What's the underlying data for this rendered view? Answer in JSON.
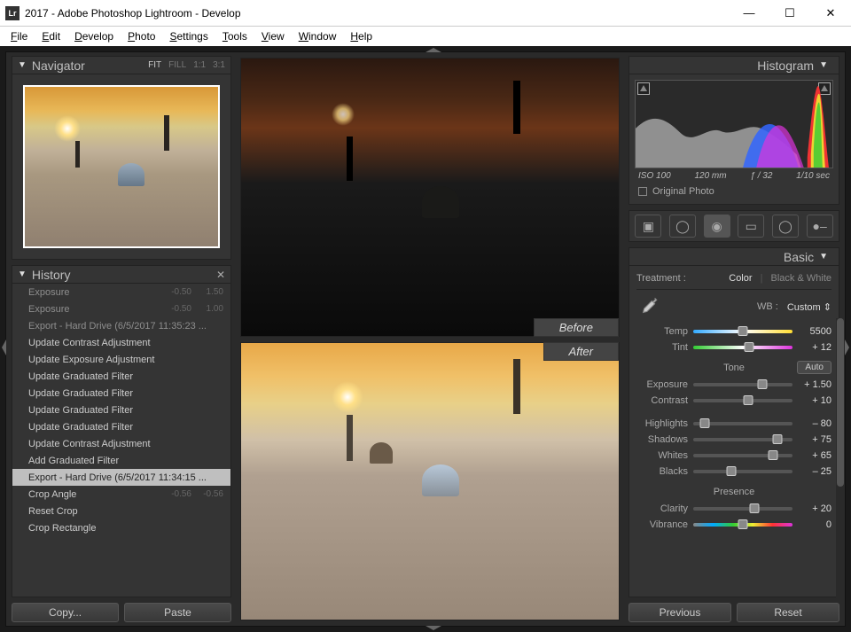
{
  "titlebar": {
    "title": "2017 - Adobe Photoshop Lightroom - Develop"
  },
  "menu": [
    "File",
    "Edit",
    "Develop",
    "Photo",
    "Settings",
    "Tools",
    "View",
    "Window",
    "Help"
  ],
  "navigator": {
    "title": "Navigator",
    "modes": [
      "FIT",
      "FILL",
      "1:1",
      "3:1"
    ],
    "active": "FIT"
  },
  "history": {
    "title": "History",
    "items": [
      {
        "label": "Exposure",
        "v1": "-0.50",
        "v2": "1.50",
        "dim": true
      },
      {
        "label": "Exposure",
        "v1": "-0.50",
        "v2": "1.00",
        "dim": true
      },
      {
        "label": "Export - Hard Drive (6/5/2017 11:35:23 ...",
        "dim": true
      },
      {
        "label": "Update Contrast Adjustment"
      },
      {
        "label": "Update Exposure Adjustment"
      },
      {
        "label": "Update Graduated Filter"
      },
      {
        "label": "Update Graduated Filter"
      },
      {
        "label": "Update Graduated Filter"
      },
      {
        "label": "Update Graduated Filter"
      },
      {
        "label": "Update Contrast Adjustment"
      },
      {
        "label": "Add Graduated Filter"
      },
      {
        "label": "Export - Hard Drive (6/5/2017 11:34:15 ...",
        "selected": true
      },
      {
        "label": "Crop Angle",
        "v1": "-0.56",
        "v2": "-0.56"
      },
      {
        "label": "Reset Crop"
      },
      {
        "label": "Crop Rectangle"
      }
    ],
    "copy_btn": "Copy...",
    "paste_btn": "Paste"
  },
  "preview": {
    "before": "Before",
    "after": "After"
  },
  "histogram": {
    "title": "Histogram",
    "iso": "ISO 100",
    "focal": "120 mm",
    "aperture": "ƒ / 32",
    "shutter": "1/10 sec",
    "original": "Original Photo"
  },
  "basic": {
    "title": "Basic",
    "treatment_lbl": "Treatment :",
    "color": "Color",
    "bw": "Black & White",
    "wb_lbl": "WB :",
    "wb_val": "Custom",
    "temp_lbl": "Temp",
    "temp_val": "5500",
    "temp_pct": 50,
    "tint_lbl": "Tint",
    "tint_val": "+ 12",
    "tint_pct": 56,
    "tone_hdr": "Tone",
    "auto": "Auto",
    "sliders": [
      {
        "lbl": "Exposure",
        "val": "+ 1.50",
        "pct": 70
      },
      {
        "lbl": "Contrast",
        "val": "+ 10",
        "pct": 55
      }
    ],
    "sliders2": [
      {
        "lbl": "Highlights",
        "val": "– 80",
        "pct": 12
      },
      {
        "lbl": "Shadows",
        "val": "+ 75",
        "pct": 85
      },
      {
        "lbl": "Whites",
        "val": "+ 65",
        "pct": 80
      },
      {
        "lbl": "Blacks",
        "val": "– 25",
        "pct": 38
      }
    ],
    "presence_hdr": "Presence",
    "sliders3": [
      {
        "lbl": "Clarity",
        "val": "+ 20",
        "pct": 62
      },
      {
        "lbl": "Vibrance",
        "val": "0",
        "pct": 50,
        "vib": true
      }
    ],
    "prev_btn": "Previous",
    "reset_btn": "Reset"
  }
}
